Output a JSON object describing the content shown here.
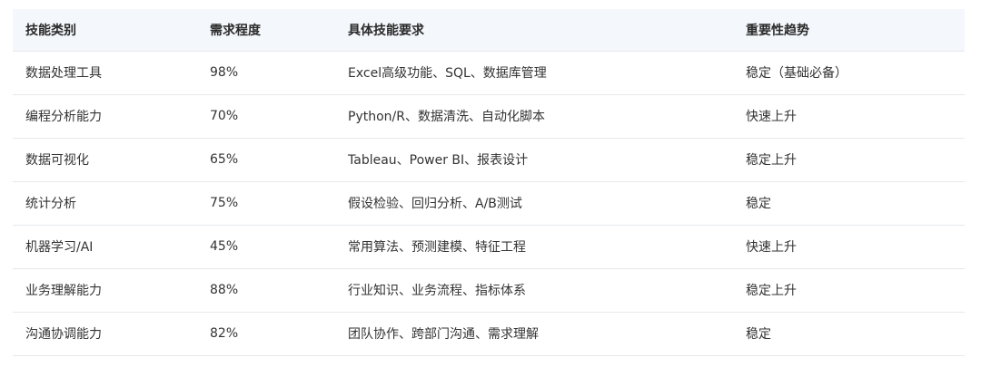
{
  "table": {
    "headers": [
      "技能类别",
      "需求程度",
      "具体技能要求",
      "重要性趋势"
    ],
    "rows": [
      [
        "数据处理工具",
        "98%",
        "Excel高级功能、SQL、数据库管理",
        "稳定（基础必备）"
      ],
      [
        "编程分析能力",
        "70%",
        "Python/R、数据清洗、自动化脚本",
        "快速上升"
      ],
      [
        "数据可视化",
        "65%",
        "Tableau、Power BI、报表设计",
        "稳定上升"
      ],
      [
        "统计分析",
        "75%",
        "假设检验、回归分析、A/B测试",
        "稳定"
      ],
      [
        "机器学习/AI",
        "45%",
        "常用算法、预测建模、特征工程",
        "快速上升"
      ],
      [
        "业务理解能力",
        "88%",
        "行业知识、业务流程、指标体系",
        "稳定上升"
      ],
      [
        "沟通协调能力",
        "82%",
        "团队协作、跨部门沟通、需求理解",
        "稳定"
      ]
    ]
  }
}
